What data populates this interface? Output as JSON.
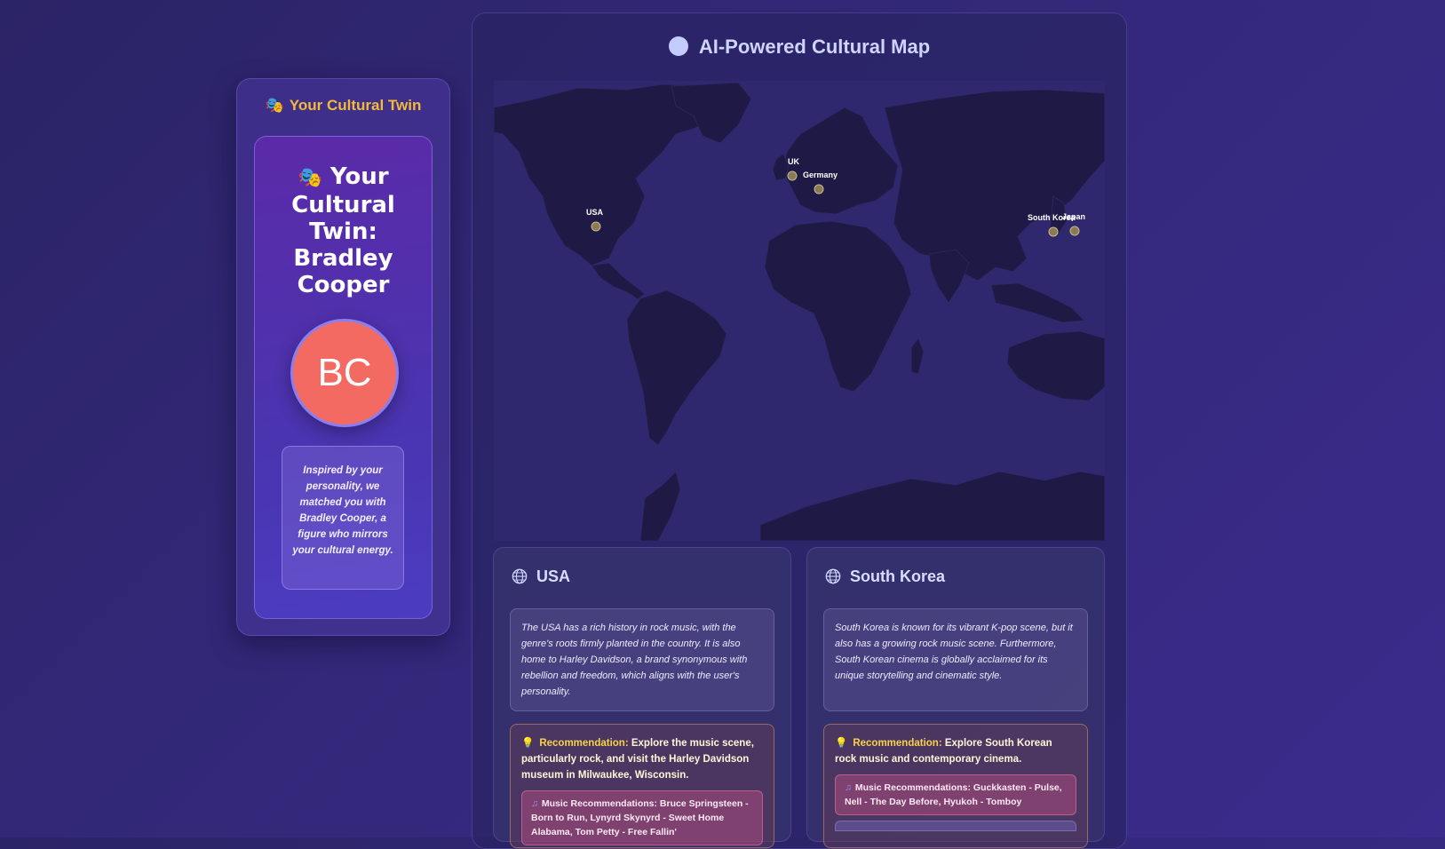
{
  "twin_panel": {
    "header_icon": "🎭",
    "header": "Your Cultural Twin",
    "card_title_icon": "🎭",
    "card_title": "Your Cultural Twin: Bradley Cooper",
    "avatar_initials": "BC",
    "description": "Inspired by your personality, we matched you with Bradley Cooper, a figure who mirrors your cultural energy."
  },
  "map_panel": {
    "title": "AI-Powered Cultural Map",
    "markers": [
      "UK",
      "Germany",
      "USA",
      "South Korea",
      "Japan"
    ]
  },
  "countries": [
    {
      "name": "USA",
      "description": "The USA has a rich history in rock music, with the genre's roots firmly planted in the country. It is also home to Harley Davidson, a brand synonymous with rebellion and freedom, which aligns with the user's personality.",
      "rec_label": "Recommendation:",
      "rec_text": "Explore the music scene, particularly rock, and visit the Harley Davidson museum in Milwaukee, Wisconsin.",
      "music": "Music Recommendations: Bruce Springsteen - Born to Run, Lynyrd Skynyrd - Sweet Home Alabama, Tom Petty - Free Fallin'"
    },
    {
      "name": "South Korea",
      "description": "South Korea is known for its vibrant K-pop scene, but it also has a growing rock music scene. Furthermore, South Korean cinema is globally acclaimed for its unique storytelling and cinematic style.",
      "rec_label": "Recommendation:",
      "rec_text": "Explore South Korean rock music and contemporary cinema.",
      "music": "Music Recommendations: Guckkasten - Pulse, Nell - The Day Before, Hyukoh - Tomboy"
    }
  ],
  "icons": {
    "globe": "globe-icon",
    "bulb": "lightbulb-icon",
    "note": "music-note-icon",
    "masks": "theater-masks-icon"
  },
  "colors": {
    "accent": "#f5b93a",
    "avatar": "#f36a63",
    "land": "#1e1a45",
    "ocean": "#30286e"
  }
}
